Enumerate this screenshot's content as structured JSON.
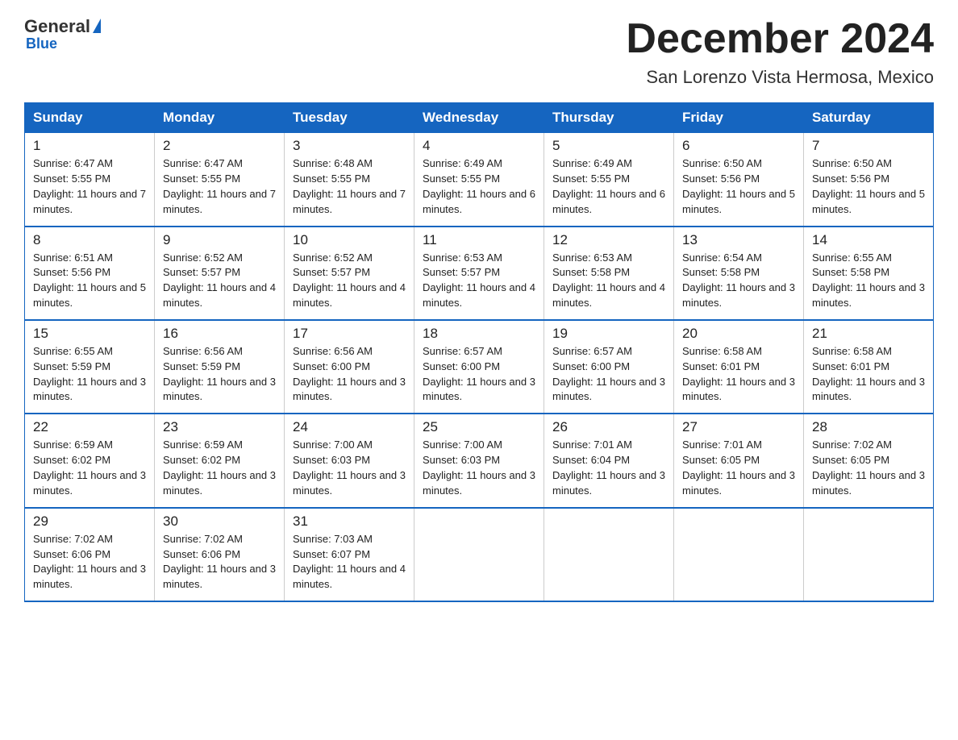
{
  "logo": {
    "general": "General",
    "blue": "Blue"
  },
  "title": "December 2024",
  "subtitle": "San Lorenzo Vista Hermosa, Mexico",
  "days_of_week": [
    "Sunday",
    "Monday",
    "Tuesday",
    "Wednesday",
    "Thursday",
    "Friday",
    "Saturday"
  ],
  "weeks": [
    [
      {
        "day": "1",
        "sunrise": "6:47 AM",
        "sunset": "5:55 PM",
        "daylight": "11 hours and 7 minutes."
      },
      {
        "day": "2",
        "sunrise": "6:47 AM",
        "sunset": "5:55 PM",
        "daylight": "11 hours and 7 minutes."
      },
      {
        "day": "3",
        "sunrise": "6:48 AM",
        "sunset": "5:55 PM",
        "daylight": "11 hours and 7 minutes."
      },
      {
        "day": "4",
        "sunrise": "6:49 AM",
        "sunset": "5:55 PM",
        "daylight": "11 hours and 6 minutes."
      },
      {
        "day": "5",
        "sunrise": "6:49 AM",
        "sunset": "5:55 PM",
        "daylight": "11 hours and 6 minutes."
      },
      {
        "day": "6",
        "sunrise": "6:50 AM",
        "sunset": "5:56 PM",
        "daylight": "11 hours and 5 minutes."
      },
      {
        "day": "7",
        "sunrise": "6:50 AM",
        "sunset": "5:56 PM",
        "daylight": "11 hours and 5 minutes."
      }
    ],
    [
      {
        "day": "8",
        "sunrise": "6:51 AM",
        "sunset": "5:56 PM",
        "daylight": "11 hours and 5 minutes."
      },
      {
        "day": "9",
        "sunrise": "6:52 AM",
        "sunset": "5:57 PM",
        "daylight": "11 hours and 4 minutes."
      },
      {
        "day": "10",
        "sunrise": "6:52 AM",
        "sunset": "5:57 PM",
        "daylight": "11 hours and 4 minutes."
      },
      {
        "day": "11",
        "sunrise": "6:53 AM",
        "sunset": "5:57 PM",
        "daylight": "11 hours and 4 minutes."
      },
      {
        "day": "12",
        "sunrise": "6:53 AM",
        "sunset": "5:58 PM",
        "daylight": "11 hours and 4 minutes."
      },
      {
        "day": "13",
        "sunrise": "6:54 AM",
        "sunset": "5:58 PM",
        "daylight": "11 hours and 3 minutes."
      },
      {
        "day": "14",
        "sunrise": "6:55 AM",
        "sunset": "5:58 PM",
        "daylight": "11 hours and 3 minutes."
      }
    ],
    [
      {
        "day": "15",
        "sunrise": "6:55 AM",
        "sunset": "5:59 PM",
        "daylight": "11 hours and 3 minutes."
      },
      {
        "day": "16",
        "sunrise": "6:56 AM",
        "sunset": "5:59 PM",
        "daylight": "11 hours and 3 minutes."
      },
      {
        "day": "17",
        "sunrise": "6:56 AM",
        "sunset": "6:00 PM",
        "daylight": "11 hours and 3 minutes."
      },
      {
        "day": "18",
        "sunrise": "6:57 AM",
        "sunset": "6:00 PM",
        "daylight": "11 hours and 3 minutes."
      },
      {
        "day": "19",
        "sunrise": "6:57 AM",
        "sunset": "6:00 PM",
        "daylight": "11 hours and 3 minutes."
      },
      {
        "day": "20",
        "sunrise": "6:58 AM",
        "sunset": "6:01 PM",
        "daylight": "11 hours and 3 minutes."
      },
      {
        "day": "21",
        "sunrise": "6:58 AM",
        "sunset": "6:01 PM",
        "daylight": "11 hours and 3 minutes."
      }
    ],
    [
      {
        "day": "22",
        "sunrise": "6:59 AM",
        "sunset": "6:02 PM",
        "daylight": "11 hours and 3 minutes."
      },
      {
        "day": "23",
        "sunrise": "6:59 AM",
        "sunset": "6:02 PM",
        "daylight": "11 hours and 3 minutes."
      },
      {
        "day": "24",
        "sunrise": "7:00 AM",
        "sunset": "6:03 PM",
        "daylight": "11 hours and 3 minutes."
      },
      {
        "day": "25",
        "sunrise": "7:00 AM",
        "sunset": "6:03 PM",
        "daylight": "11 hours and 3 minutes."
      },
      {
        "day": "26",
        "sunrise": "7:01 AM",
        "sunset": "6:04 PM",
        "daylight": "11 hours and 3 minutes."
      },
      {
        "day": "27",
        "sunrise": "7:01 AM",
        "sunset": "6:05 PM",
        "daylight": "11 hours and 3 minutes."
      },
      {
        "day": "28",
        "sunrise": "7:02 AM",
        "sunset": "6:05 PM",
        "daylight": "11 hours and 3 minutes."
      }
    ],
    [
      {
        "day": "29",
        "sunrise": "7:02 AM",
        "sunset": "6:06 PM",
        "daylight": "11 hours and 3 minutes."
      },
      {
        "day": "30",
        "sunrise": "7:02 AM",
        "sunset": "6:06 PM",
        "daylight": "11 hours and 3 minutes."
      },
      {
        "day": "31",
        "sunrise": "7:03 AM",
        "sunset": "6:07 PM",
        "daylight": "11 hours and 4 minutes."
      },
      null,
      null,
      null,
      null
    ]
  ]
}
